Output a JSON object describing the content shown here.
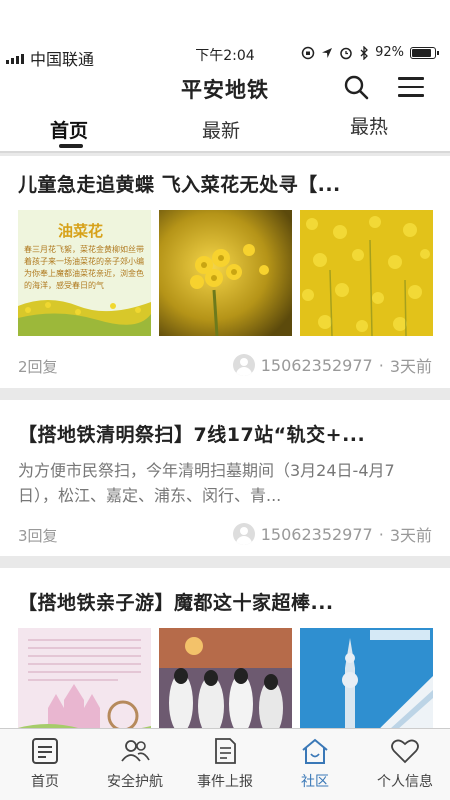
{
  "status_bar": {
    "carrier": "中国联通",
    "time": "下午2:04",
    "battery": "92%",
    "battery_level": 0.92
  },
  "header": {
    "title": "平安地铁",
    "icons": [
      "search-icon",
      "menu-icon"
    ]
  },
  "tabs": [
    {
      "label": "首页",
      "active": true
    },
    {
      "label": "最新",
      "active": false
    },
    {
      "label": "最热",
      "active": false
    }
  ],
  "posts": [
    {
      "title": "儿童急走追黄蝶 飞入菜花无处寻【...",
      "replies": "2回复",
      "author": "15062352977",
      "time": "3天前",
      "thumb1": {
        "heading": "油菜花",
        "text": "春三月花飞絮，菜花金黄柳如丝带着孩子来一场油菜花的亲子郊小编为你奉上魔都油菜花亲近，浏金色的海洋，感受春日的气"
      }
    },
    {
      "title": "【搭地铁清明祭扫】7线17站“轨交+...",
      "summary": "为方便市民祭扫，今年清明扫墓期间（3月24日-4月7日），松江、嘉定、浦东、闵行、青...",
      "replies": "3回复",
      "author": "15062352977",
      "time": "3天前"
    },
    {
      "title": "【搭地铁亲子游】魔都这十家超棒..."
    }
  ],
  "bottom_nav": [
    {
      "label": "首页",
      "icon": "home-list-icon",
      "active": false
    },
    {
      "label": "安全护航",
      "icon": "people-icon",
      "active": false
    },
    {
      "label": "事件上报",
      "icon": "report-icon",
      "active": false
    },
    {
      "label": "社区",
      "icon": "community-home-icon",
      "active": true
    },
    {
      "label": "个人信息",
      "icon": "heart-icon",
      "active": false
    }
  ],
  "colors": {
    "accent": "#3a78b7",
    "rapeseed_yellow": "#e2c21a"
  }
}
